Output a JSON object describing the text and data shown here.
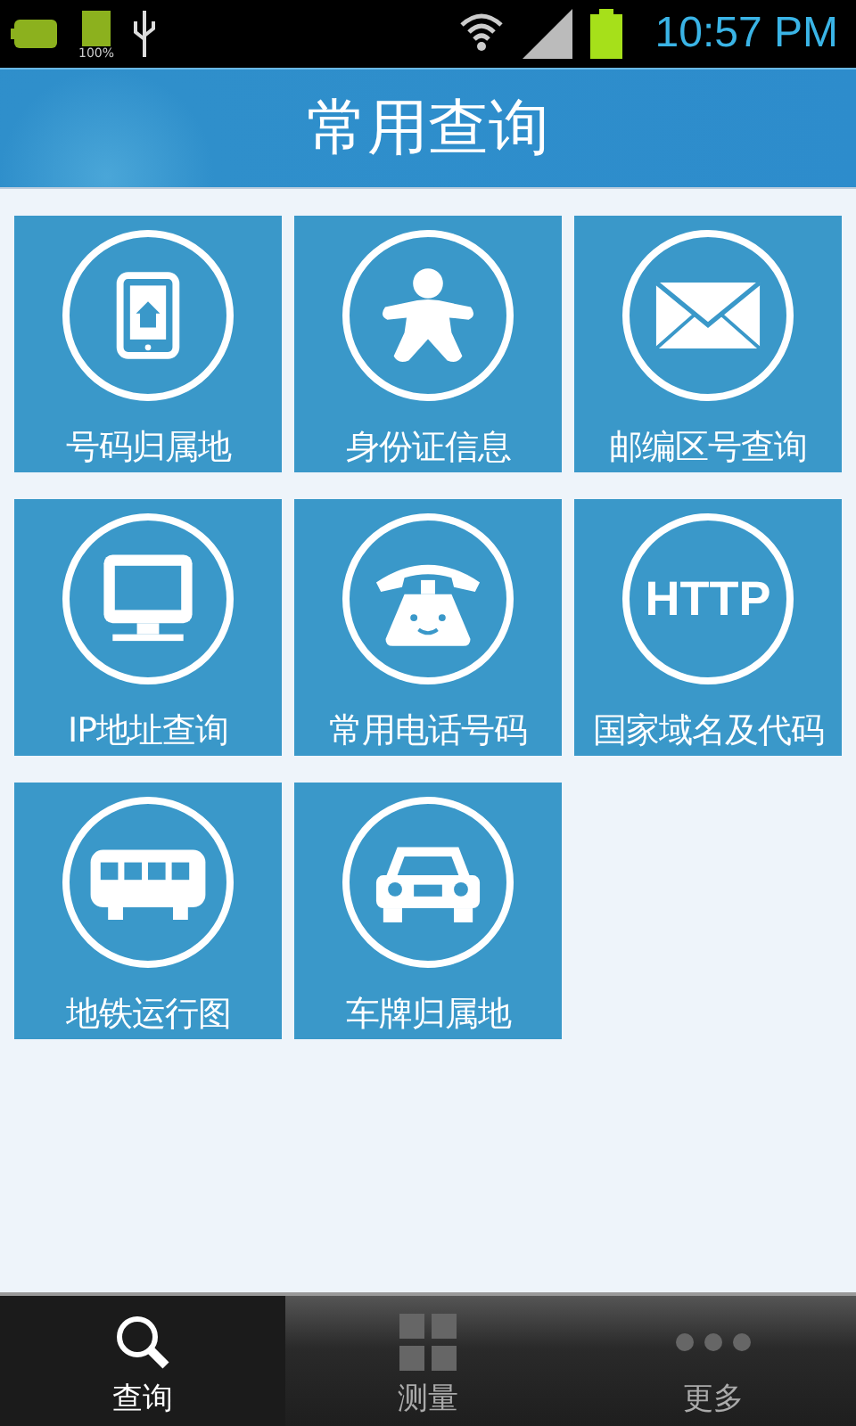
{
  "status_bar": {
    "battery_text": "100%",
    "time": "10:57 PM"
  },
  "header": {
    "title": "常用查询"
  },
  "tiles": [
    {
      "kind": "tablet",
      "label": "号码归属地"
    },
    {
      "kind": "person",
      "label": "身份证信息"
    },
    {
      "kind": "mail",
      "label": "邮编区号查询"
    },
    {
      "kind": "monitor",
      "label": "IP地址查询"
    },
    {
      "kind": "phone",
      "label": "常用电话号码"
    },
    {
      "kind": "text",
      "icon_text": "HTTP",
      "label": "国家域名及代码"
    },
    {
      "kind": "bus",
      "label": "地铁运行图"
    },
    {
      "kind": "car",
      "label": "车牌归属地"
    }
  ],
  "tabs": [
    {
      "kind": "search",
      "label": "查询",
      "selected": true
    },
    {
      "kind": "grid",
      "label": "测量",
      "selected": false
    },
    {
      "kind": "dots",
      "label": "更多",
      "selected": false
    }
  ]
}
